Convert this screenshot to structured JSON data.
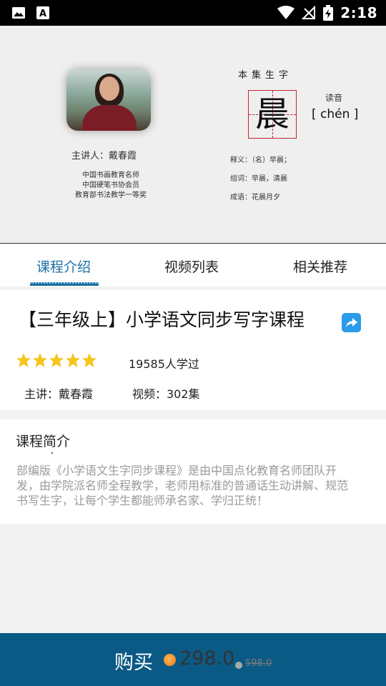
{
  "status_bar": {
    "time": "2:18",
    "left_icons": [
      "image-icon",
      "text-a-icon"
    ],
    "right_icons": [
      "wifi-icon",
      "signal-off-icon",
      "battery-charging-icon"
    ]
  },
  "banner": {
    "teacher_name": "主讲人：戴春霞",
    "teacher_titles": [
      "中国书画教育名师",
      "中国硬笔书协会员",
      "教育部书法教学一等奖"
    ],
    "char_heading": "本集生字",
    "character": "晨",
    "reading_label": "读音",
    "pinyin": "[ chén ]",
    "definition": "释义：（名）早晨；",
    "words": "组词：早晨，清晨",
    "idiom": "成语：花晨月夕"
  },
  "tabs": [
    {
      "label": "课程介绍",
      "active": true
    },
    {
      "label": "视频列表",
      "active": false
    },
    {
      "label": "相关推荐",
      "active": false
    }
  ],
  "course": {
    "title": "【三年级上】小学语文同步写字课程",
    "rating": 5,
    "rating_max": 5,
    "learners": "19585人学过",
    "lecturer": "主讲：戴春霞",
    "videos": "视频：302集"
  },
  "intro": {
    "heading": "课程简介",
    "text": "部编版《小学语文生字同步课程》是由中国点化教育名师团队开发，由学院派名师全程教学，老师用标准的普通话生动讲解、规范书写生字，让每个学生都能师承名家、学归正统！"
  },
  "purchase": {
    "label": "购买",
    "price": "298.0",
    "original_price": "598.0"
  },
  "colors": {
    "accent": "#1d6fa3",
    "buy_bar": "#0b5a85",
    "star": "#f5c518",
    "share": "#2b9bea",
    "coin": "#f07b10"
  }
}
